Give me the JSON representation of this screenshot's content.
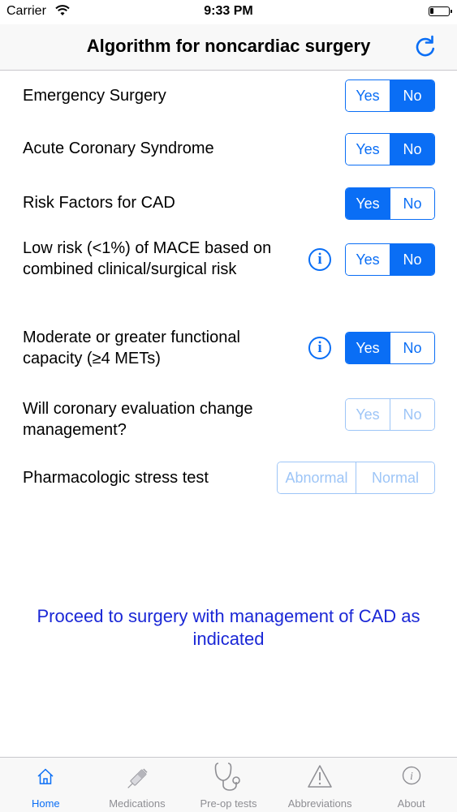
{
  "status_bar": {
    "carrier": "Carrier",
    "time": "9:33 PM"
  },
  "nav": {
    "title": "Algorithm for noncardiac surgery"
  },
  "questions": [
    {
      "label": "Emergency Surgery",
      "options": [
        "Yes",
        "No"
      ],
      "selected": "No",
      "enabled": true
    },
    {
      "label": "Acute Coronary Syndrome",
      "options": [
        "Yes",
        "No"
      ],
      "selected": "No",
      "enabled": true
    },
    {
      "label": "Risk Factors for CAD",
      "options": [
        "Yes",
        "No"
      ],
      "selected": "Yes",
      "enabled": true
    },
    {
      "label_line1": "Low risk (<1%) of MACE based on",
      "label_line2": "combined clinical/surgical risk",
      "options": [
        "Yes",
        "No"
      ],
      "selected": "No",
      "enabled": true,
      "has_info": true
    },
    {
      "label_line1": "Moderate or greater functional",
      "label_line2": "capacity (≥4 METs)",
      "options": [
        "Yes",
        "No"
      ],
      "selected": "Yes",
      "enabled": true,
      "has_info": true
    },
    {
      "label_line1": "Will coronary evaluation change",
      "label_line2": "management?",
      "options": [
        "Yes",
        "No"
      ],
      "selected": null,
      "enabled": false
    },
    {
      "label": "Pharmacologic stress test",
      "options": [
        "Abnormal",
        "Normal"
      ],
      "selected": null,
      "enabled": false
    }
  ],
  "result": {
    "line1": "Proceed to surgery with management of CAD as",
    "line2": "indicated"
  },
  "tabs": [
    {
      "label": "Home",
      "icon": "home-icon",
      "active": true
    },
    {
      "label": "Medications",
      "icon": "syringe-icon",
      "active": false
    },
    {
      "label": "Pre-op tests",
      "icon": "stethoscope-icon",
      "active": false
    },
    {
      "label": "Abbreviations",
      "icon": "warning-icon",
      "active": false
    },
    {
      "label": "About",
      "icon": "info-icon",
      "active": false
    }
  ],
  "colors": {
    "accent": "#0a6ef5",
    "result_text": "#1a27d6",
    "disabled": "#9dc5f7"
  }
}
